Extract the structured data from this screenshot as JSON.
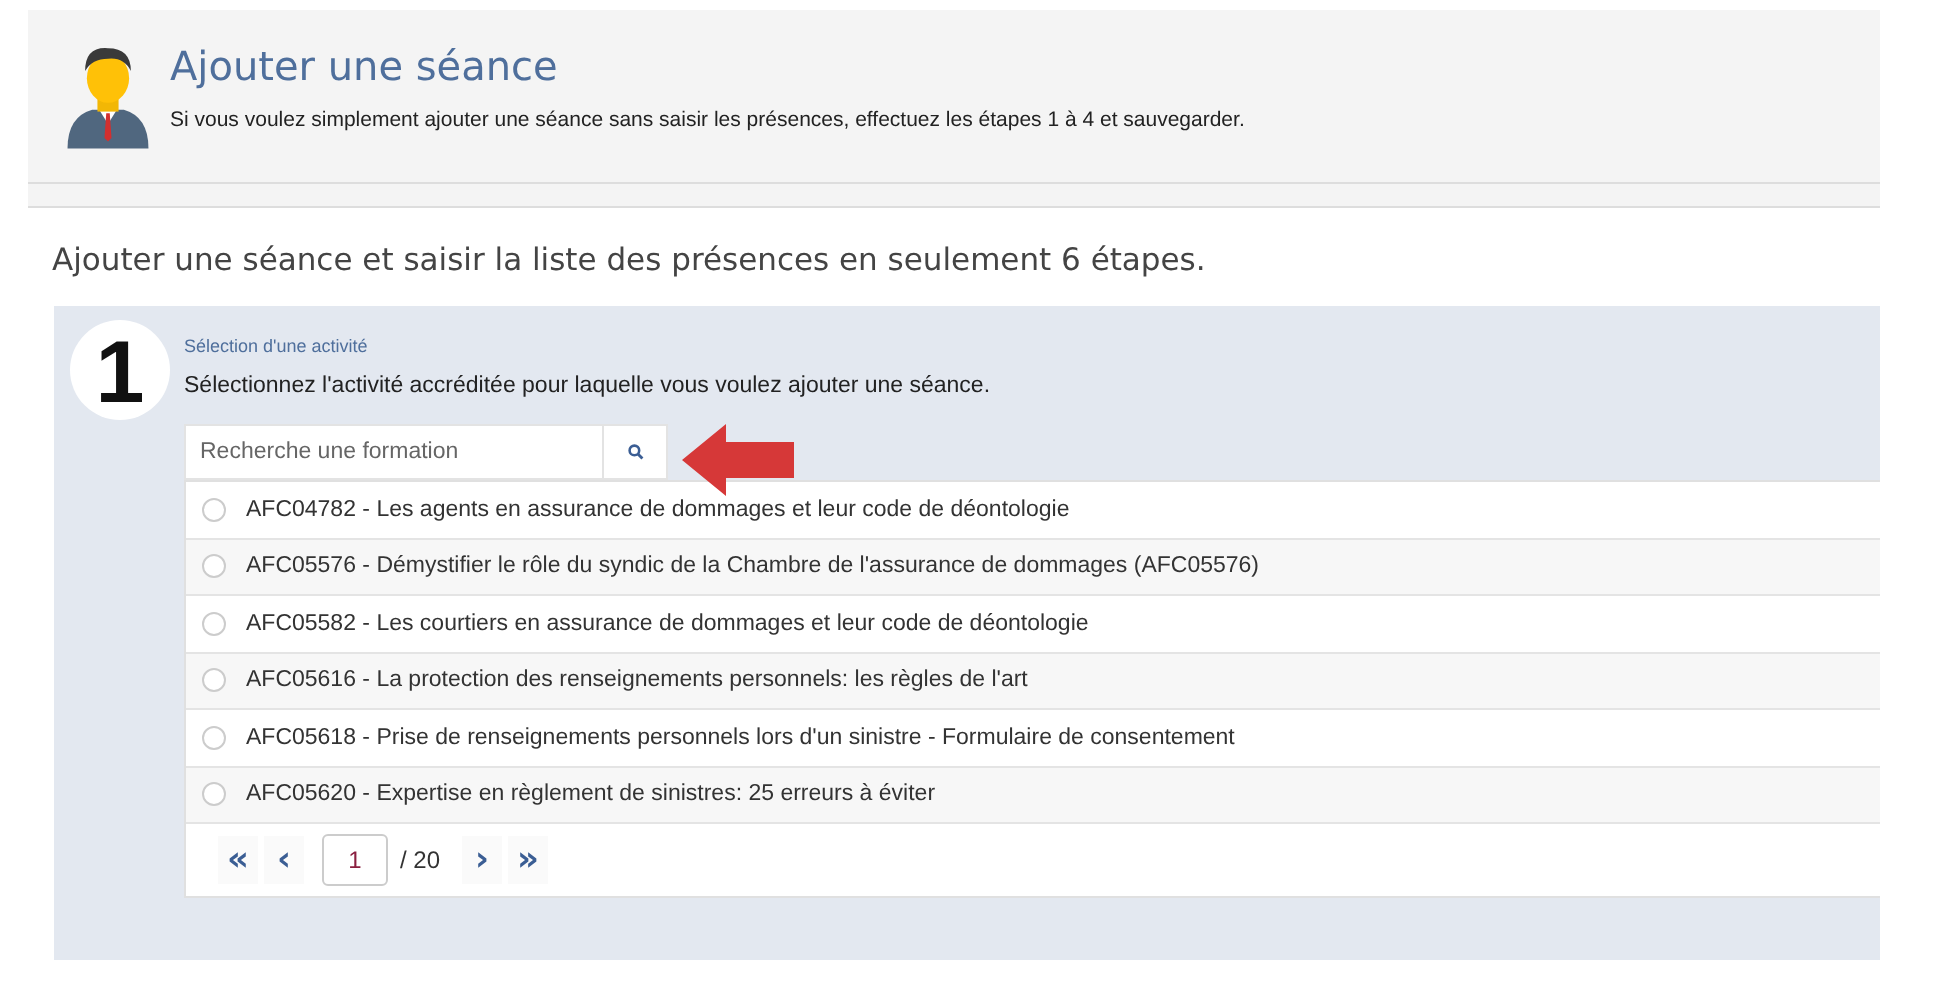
{
  "header": {
    "title": "Ajouter une séance",
    "subtitle": "Si vous voulez simplement ajouter une séance sans saisir les présences, effectuez les étapes 1 à 4 et sauvegarder."
  },
  "intro": "Ajouter une séance et saisir la liste des présences en seulement 6 étapes.",
  "step": {
    "number": "1",
    "title": "Sélection d'une activité",
    "description": "Sélectionnez l'activité accréditée pour laquelle vous voulez ajouter une séance.",
    "search": {
      "placeholder": "Recherche une formation"
    },
    "activities": [
      {
        "label": "AFC04782 - Les agents en assurance de dommages et leur code de déontologie",
        "selected": false
      },
      {
        "label": "AFC05576 - Démystifier le rôle du syndic de la Chambre de l'assurance de dommages (AFC05576)",
        "selected": false
      },
      {
        "label": "AFC05582 - Les courtiers en assurance de dommages et leur code de déontologie",
        "selected": false
      },
      {
        "label": "AFC05616 - La protection des renseignements personnels: les règles de l'art",
        "selected": false
      },
      {
        "label": "AFC05618 - Prise de renseignements personnels lors d'un sinistre - Formulaire de consentement",
        "selected": false
      },
      {
        "label": "AFC05620 - Expertise en règlement de sinistres: 25 erreurs à éviter",
        "selected": false
      }
    ],
    "pagination": {
      "first": "«",
      "previous": "‹",
      "page": "1",
      "total": "/ 20",
      "next": "›",
      "last": "»"
    }
  }
}
